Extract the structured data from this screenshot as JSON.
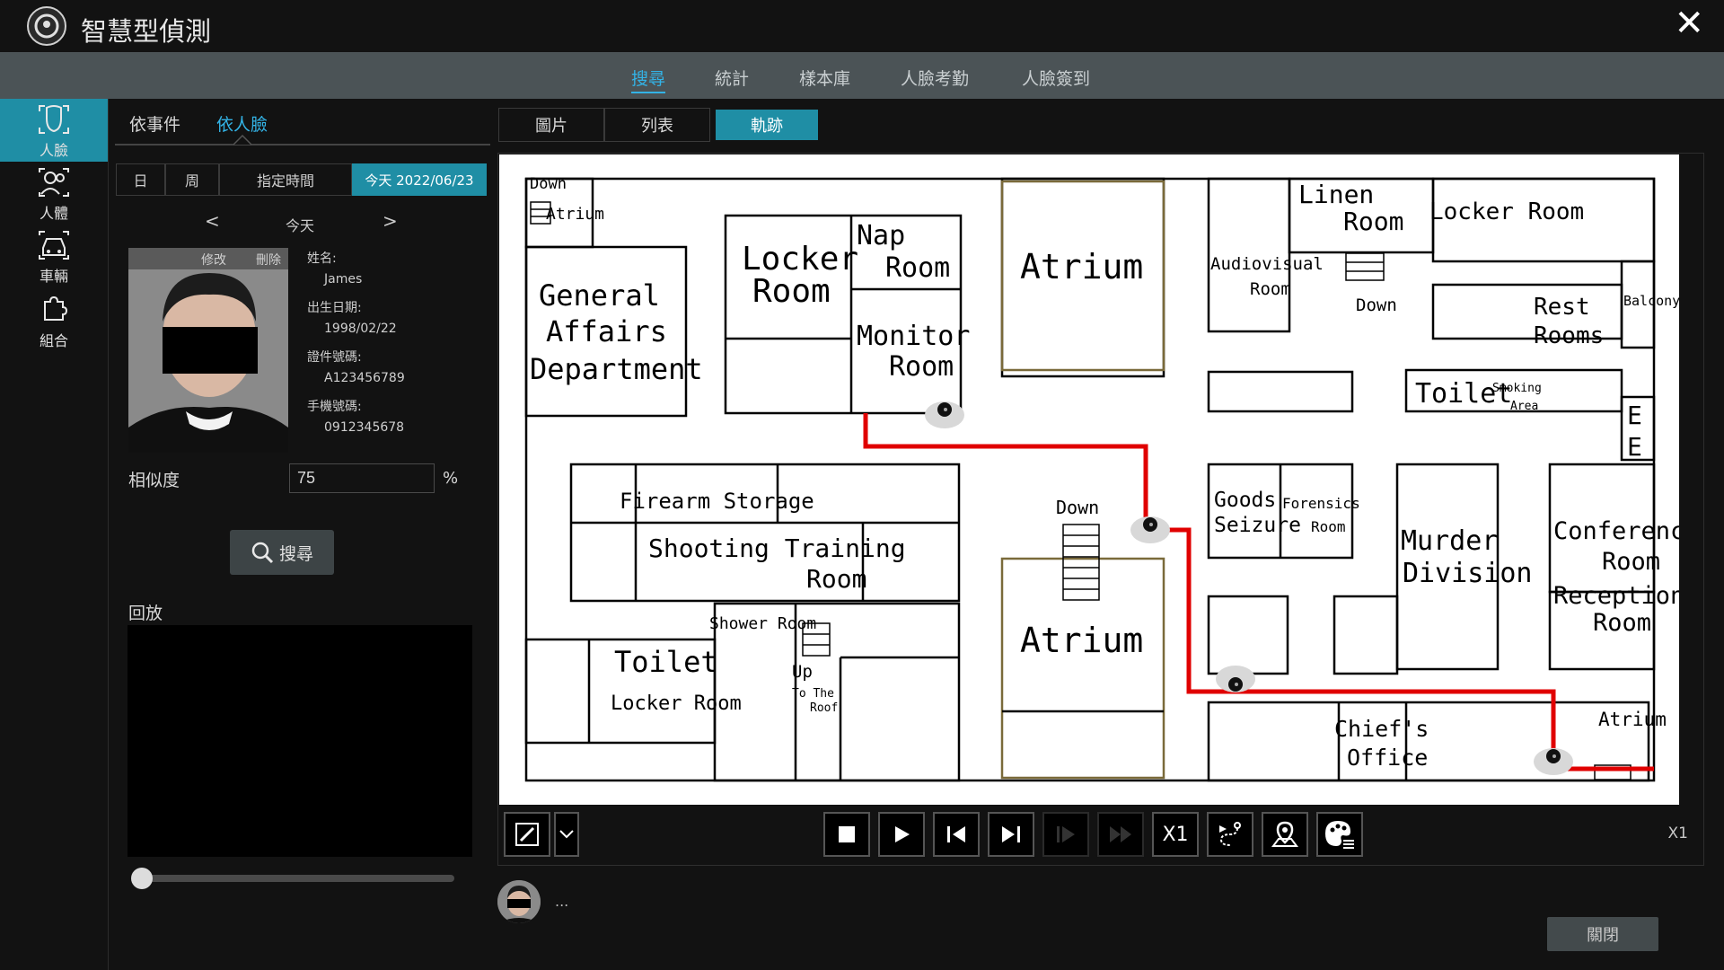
{
  "app": {
    "title": "智慧型偵測",
    "close_glyph": "✕"
  },
  "topnav": {
    "tabs": [
      "搜尋",
      "統計",
      "樣本庫",
      "人臉考勤",
      "人臉簽到"
    ],
    "active": "搜尋"
  },
  "rail": {
    "items": [
      {
        "label": "人臉",
        "icon": "face-icon",
        "active": true
      },
      {
        "label": "人體",
        "icon": "person-icon"
      },
      {
        "label": "車輛",
        "icon": "car-icon"
      },
      {
        "label": "組合",
        "icon": "puzzle-icon"
      }
    ]
  },
  "left": {
    "subtabs": [
      "依事件",
      "依人臉"
    ],
    "active_subtab": "依人臉",
    "range": {
      "day": "日",
      "week": "周",
      "custom": "指定時間",
      "today": "今天 2022/06/23"
    },
    "date_nav": {
      "prev": "<",
      "label": "今天",
      "next": ">"
    },
    "photo_actions": {
      "edit": "修改",
      "delete": "刪除"
    },
    "person": {
      "name_label": "姓名:",
      "name": "James",
      "dob_label": "出生日期:",
      "dob": "1998/02/22",
      "id_label": "證件號碼:",
      "id": "A123456789",
      "phone_label": "手機號碼:",
      "phone": "0912345678"
    },
    "similarity": {
      "label": "相似度",
      "value": "75",
      "unit": "%"
    },
    "search_label": "搜尋",
    "playback_label": "回放",
    "playback_position": 0
  },
  "view_tabs": {
    "tabs": [
      "圖片",
      "列表",
      "軌跡"
    ],
    "active": "軌跡"
  },
  "map": {
    "rooms": {
      "down_tl": "Down",
      "atrium_small": "Atrium",
      "general": "General",
      "affairs": "Affairs",
      "department": "Department",
      "locker": "Locker",
      "room": "Room",
      "nap": "Nap",
      "monitor": "Monitor",
      "atrium_top": "Atrium",
      "linen": "Linen",
      "audiovisual": "Audiovisual",
      "locker_room_r": "Locker Room",
      "down_r": "Down",
      "rest": "Rest",
      "rooms": "Rooms",
      "balcony": "Balcony",
      "toilet_r": "Toilet",
      "smoking": "Smoking",
      "area": "Area",
      "e": "E",
      "firearm": "Firearm Storage",
      "shooting": "Shooting Training",
      "down_mid": "Down",
      "goods": "Goods",
      "seizure": "Seizure",
      "forensics": "Forensics",
      "murder": "Murder",
      "division": "Division",
      "conference": "Conference",
      "reception": "Reception",
      "shower": "Shower Room",
      "toilet_l": "Toilet",
      "locker_room_l": "Locker Room",
      "up": "Up",
      "to_the": "To The",
      "roof": "Roof",
      "atrium_bottom": "Atrium",
      "chiefs": "Chief's",
      "office": "Office",
      "atrium_br": "Atrium"
    },
    "cameras": 4,
    "track_color": "#e00000"
  },
  "controls": {
    "buttons": [
      "edit-tool-icon",
      "chevron-down-icon",
      "stop-icon",
      "play-icon",
      "skip-back-icon",
      "skip-end-icon",
      "step-forward-icon",
      "fast-forward-icon",
      "speed-icon",
      "route-icon",
      "map-pin-icon",
      "palette-icon"
    ],
    "speed_button_label": "X1",
    "speed_readout": "X1"
  },
  "result": {
    "more": "..."
  },
  "footer": {
    "close_label": "關閉"
  },
  "colors": {
    "accent": "#1f8ea5",
    "active_text": "#33b3e6",
    "nav_bg": "#4b5356"
  }
}
